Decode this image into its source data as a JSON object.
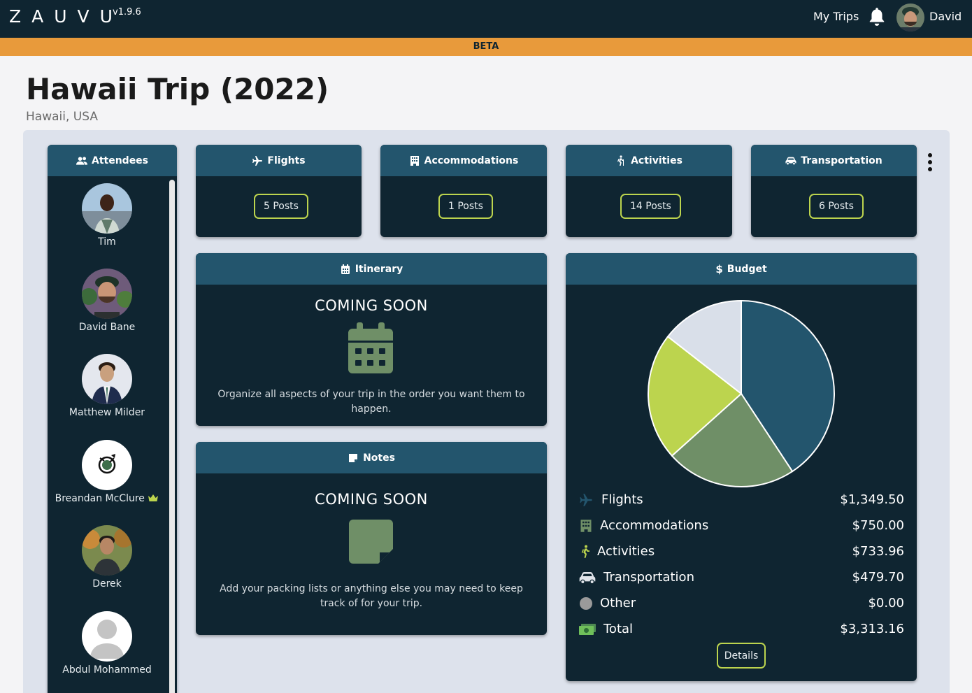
{
  "header": {
    "logo": "ZAUVU",
    "version": "v1.9.6",
    "nav_my_trips": "My Trips",
    "user_name": "David"
  },
  "banner": {
    "label": "BETA"
  },
  "trip": {
    "title": "Hawaii Trip (2022)",
    "location": "Hawaii, USA"
  },
  "attendees": {
    "title": "Attendees",
    "items": [
      {
        "name": "Tim"
      },
      {
        "name": "David Bane"
      },
      {
        "name": "Matthew Milder"
      },
      {
        "name": "Breandan McClure"
      },
      {
        "name": "Derek"
      },
      {
        "name": "Abdul Mohammed"
      }
    ]
  },
  "categories": [
    {
      "title": "Flights",
      "posts": "5 Posts",
      "icon": "plane-icon"
    },
    {
      "title": "Accommodations",
      "posts": "1 Posts",
      "icon": "building-icon"
    },
    {
      "title": "Activities",
      "posts": "14 Posts",
      "icon": "hiking-icon"
    },
    {
      "title": "Transportation",
      "posts": "6 Posts",
      "icon": "car-icon"
    }
  ],
  "itinerary": {
    "title": "Itinerary",
    "status": "COMING SOON",
    "description": "Organize all aspects of your trip in the order you want them to happen."
  },
  "notes": {
    "title": "Notes",
    "status": "COMING SOON",
    "description": "Add your packing lists or anything else you may need to keep track of for your trip."
  },
  "budget": {
    "title": "Budget",
    "details_label": "Details",
    "rows": [
      {
        "label": "Flights",
        "value": "$1,349.50"
      },
      {
        "label": "Accommodations",
        "value": "$750.00"
      },
      {
        "label": "Activities",
        "value": "$733.96"
      },
      {
        "label": "Transportation",
        "value": "$479.70"
      },
      {
        "label": "Other",
        "value": "$0.00"
      },
      {
        "label": "Total",
        "value": "$3,313.16"
      }
    ]
  },
  "chart_data": {
    "type": "pie",
    "categories": [
      "Flights",
      "Accommodations",
      "Activities",
      "Transportation",
      "Other"
    ],
    "values": [
      1349.5,
      750.0,
      733.96,
      479.7,
      0.0
    ],
    "colors": [
      "#23556d",
      "#6f8f67",
      "#bcd44e",
      "#d9dfe9",
      "#9a9a9a"
    ]
  },
  "colors": {
    "navy": "#0f2531",
    "card_header": "#23556d",
    "accent_lime": "#bcd44e",
    "beta_orange": "#e89a3b",
    "green_icon": "#6f8f67"
  }
}
